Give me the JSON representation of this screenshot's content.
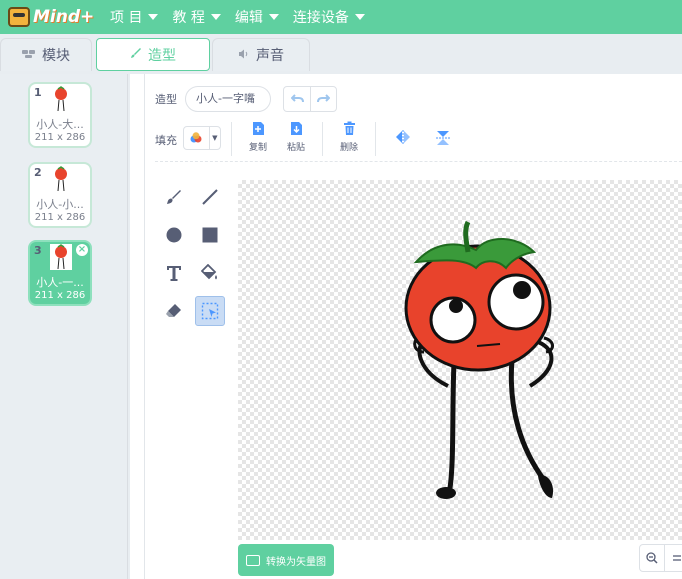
{
  "app": {
    "logo_text": "Mind+"
  },
  "menu": [
    {
      "label": "项 目"
    },
    {
      "label": "教 程"
    },
    {
      "label": "编辑"
    },
    {
      "label": "连接设备"
    }
  ],
  "tabs": [
    {
      "label": "模块",
      "icon": "blocks-icon"
    },
    {
      "label": "造型",
      "icon": "brush-icon",
      "active": true
    },
    {
      "label": "声音",
      "icon": "speaker-icon"
    }
  ],
  "costumes": [
    {
      "num": "1",
      "name": "小人-大...",
      "size": "211 x 286"
    },
    {
      "num": "2",
      "name": "小人-小...",
      "size": "211 x 286"
    },
    {
      "num": "3",
      "name": "小人-一...",
      "size": "211 x 286",
      "selected": true
    }
  ],
  "editor": {
    "costume_label": "造型",
    "costume_name": "小人-一字嘴",
    "fill_label": "填充",
    "copy_label": "复制",
    "paste_label": "粘贴",
    "delete_label": "删除",
    "convert_label": "转换为矢量图"
  },
  "colors": {
    "accent": "#5fd0a0",
    "tool_blue": "#4c97ff",
    "tomato": "#e8432c"
  }
}
